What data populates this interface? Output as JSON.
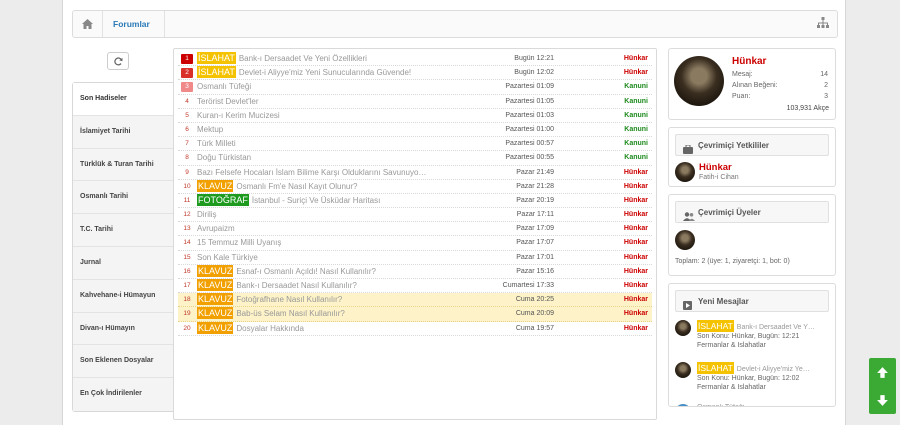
{
  "breadcrumb": {
    "forum_label": "Forumlar"
  },
  "sidebar": {
    "tabs": [
      {
        "label": "Son Hadiseler"
      },
      {
        "label": "İslamiyet Tarihi"
      },
      {
        "label": "Türklük & Turan Tarihi"
      },
      {
        "label": "Osmanlı Tarihi"
      },
      {
        "label": "T.C. Tarihi"
      },
      {
        "label": "Jurnal"
      },
      {
        "label": "Kahvehane-i Hümayun"
      },
      {
        "label": "Divan-ı Hümayın"
      },
      {
        "label": "Son Eklenen Dosyalar"
      },
      {
        "label": "En Çok İndirilenler"
      }
    ]
  },
  "threads": [
    {
      "num": "1",
      "prefix": "İSLAHAT",
      "title": "Bank-ı Dersaadet Ve Yeni Özellikleri",
      "date": "Bugün 12:21",
      "author": "Hünkar"
    },
    {
      "num": "2",
      "prefix": "İSLAHAT",
      "title": "Devlet-i Aliyye'miz Yeni Sunucularında Güvende!",
      "date": "Bugün 12:02",
      "author": "Hünkar"
    },
    {
      "num": "3",
      "prefix": "",
      "title": "Osmanlı Tüfeği",
      "date": "Pazartesi 01:09",
      "author": "Kanuni"
    },
    {
      "num": "4",
      "prefix": "",
      "title": "Terörist Devlet'ler",
      "date": "Pazartesi 01:05",
      "author": "Kanuni"
    },
    {
      "num": "5",
      "prefix": "",
      "title": "Kuran-ı Kerim Mucizesi",
      "date": "Pazartesi 01:03",
      "author": "Kanuni"
    },
    {
      "num": "6",
      "prefix": "",
      "title": "Mektup",
      "date": "Pazartesi 01:00",
      "author": "Kanuni"
    },
    {
      "num": "7",
      "prefix": "",
      "title": "Türk Milleti",
      "date": "Pazartesi 00:57",
      "author": "Kanuni"
    },
    {
      "num": "8",
      "prefix": "",
      "title": "Doğu Türkistan",
      "date": "Pazartesi 00:55",
      "author": "Kanuni"
    },
    {
      "num": "9",
      "prefix": "",
      "title": "Bazı Felsefe Hocaları İslam Bilime Karşı Olduklarını Savunuyo…",
      "date": "Pazar 21:49",
      "author": "Hünkar"
    },
    {
      "num": "10",
      "prefix": "KLAVUZ",
      "title": "Osmanlı Fm'e Nasıl Kayıt Olunur?",
      "date": "Pazar 21:28",
      "author": "Hünkar"
    },
    {
      "num": "11",
      "prefix": "FOTOĞRAF",
      "title": "İstanbul - Suriçi Ve Üsküdar Haritası",
      "date": "Pazar 20:19",
      "author": "Hünkar"
    },
    {
      "num": "12",
      "prefix": "",
      "title": "Diriliş",
      "date": "Pazar 17:11",
      "author": "Hünkar"
    },
    {
      "num": "13",
      "prefix": "",
      "title": "Avrupaizm",
      "date": "Pazar 17:09",
      "author": "Hünkar"
    },
    {
      "num": "14",
      "prefix": "",
      "title": "15 Temmuz Milli Uyanış",
      "date": "Pazar 17:07",
      "author": "Hünkar"
    },
    {
      "num": "15",
      "prefix": "",
      "title": "Son Kale Türkiye",
      "date": "Pazar 17:01",
      "author": "Hünkar"
    },
    {
      "num": "16",
      "prefix": "KLAVUZ",
      "title": "Esnaf-ı Osmanlı Açıldı! Nasıl Kullanılır?",
      "date": "Pazar 15:16",
      "author": "Hünkar"
    },
    {
      "num": "17",
      "prefix": "KLAVUZ",
      "title": "Bank-ı Dersaadet Nasıl Kullanılır?",
      "date": "Cumartesi 17:33",
      "author": "Hünkar"
    },
    {
      "num": "18",
      "prefix": "KLAVUZ",
      "title": "Fotoğrafhane Nasıl Kullanılır?",
      "date": "Cuma 20:25",
      "author": "Hünkar"
    },
    {
      "num": "19",
      "prefix": "KLAVUZ",
      "title": "Bab-üs Selam Nasıl Kullanılır?",
      "date": "Cuma 20:09",
      "author": "Hünkar"
    },
    {
      "num": "20",
      "prefix": "KLAVUZ",
      "title": "Dosyalar Hakkında",
      "date": "Cuma 19:57",
      "author": "Hünkar"
    }
  ],
  "user": {
    "name": "Hünkar",
    "mesaj_label": "Mesaj:",
    "mesaj": "14",
    "begeni_label": "Alınan Beğeni:",
    "begeni": "2",
    "puan_label": "Puan:",
    "puan": "3",
    "akce": "103,931 Akçe"
  },
  "staff": {
    "title": "Çevrimiçi Yetkililer",
    "name": "Hünkar",
    "rank": "Fatih-i Cihan"
  },
  "online": {
    "title": "Çevrimiçi Üyeler",
    "summary": "Toplam: 2 (üye: 1, ziyaretçi: 1, bot: 0)"
  },
  "messages": {
    "title": "Yeni Mesajlar",
    "items": [
      {
        "prefix": "İSLAHAT",
        "title": "Bank-ı Dersaadet Ve Y…",
        "line1": "Son Konu: Hünkar, Bugün: 12:21",
        "line2": "Fermanlar & Islahatlar"
      },
      {
        "prefix": "İSLAHAT",
        "title": "Devlet-i Aliyye'miz Ye…",
        "line1": "Son Konu: Hünkar, Bugün: 12:02",
        "line2": "Fermanlar & Islahatlar"
      },
      {
        "prefix": "",
        "title": "Osmanlı Tüfeği",
        "line1": "",
        "line2": ""
      }
    ]
  },
  "colors": {
    "accent_blue": "#2a7ab8",
    "author_red": "#cc0000",
    "author_green": "#1e8a1e",
    "scroll_green": "#3aaa35"
  }
}
